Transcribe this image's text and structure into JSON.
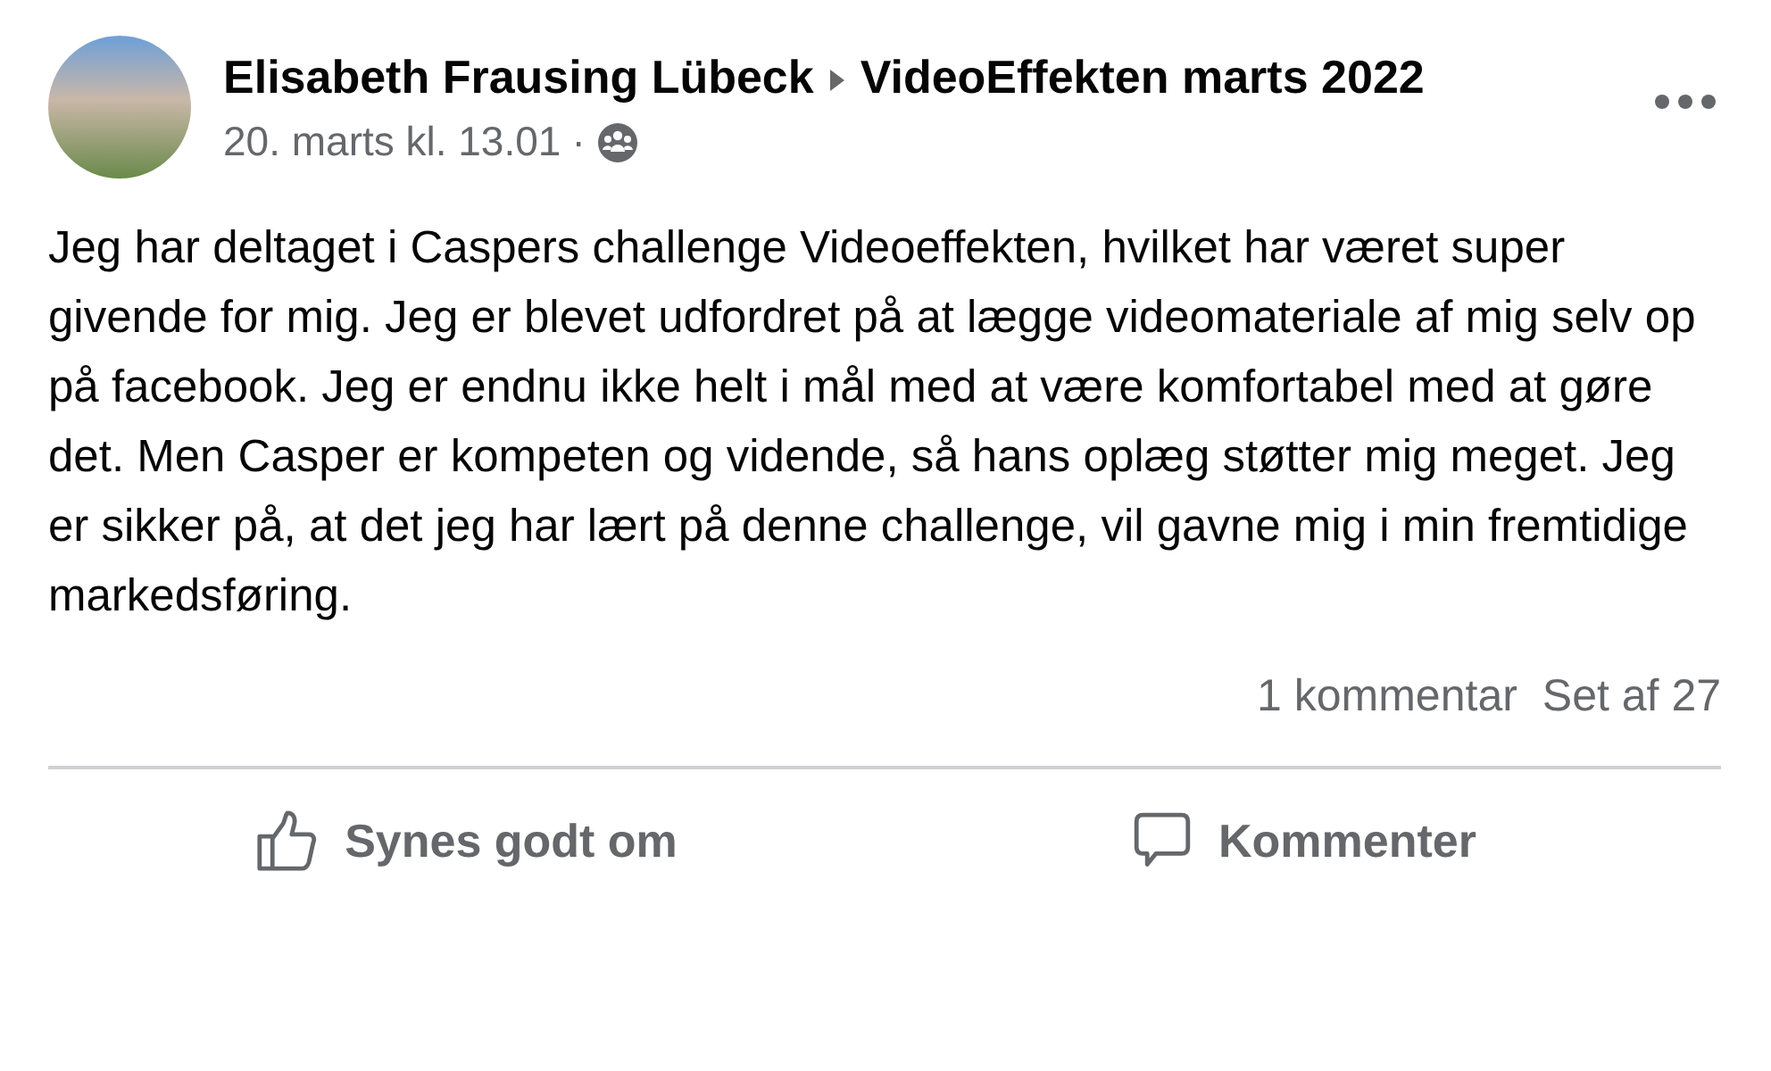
{
  "post": {
    "author": "Elisabeth Frausing Lübeck",
    "group": "VideoEffekten marts 2022",
    "timestamp": "20. marts kl. 13.01",
    "separator": "·",
    "body": "Jeg har deltaget i Caspers challenge Videoeffekten, hvilket har været super givende for mig. Jeg er blevet udfordret på at lægge videomateriale af mig selv op på facebook. Jeg er endnu ikke helt i mål med at være komfortabel med at gøre det. Men Casper er kompeten og vidende, så hans oplæg støtter mig meget. Jeg er sikker på, at det jeg har lært på denne challenge, vil gavne mig i min fremtidige markedsføring.",
    "comments": "1 kommentar",
    "seen_by": "Set af 27"
  },
  "actions": [
    {
      "kind": "like",
      "label": "Synes godt om"
    },
    {
      "kind": "comment",
      "label": "Kommenter"
    }
  ]
}
